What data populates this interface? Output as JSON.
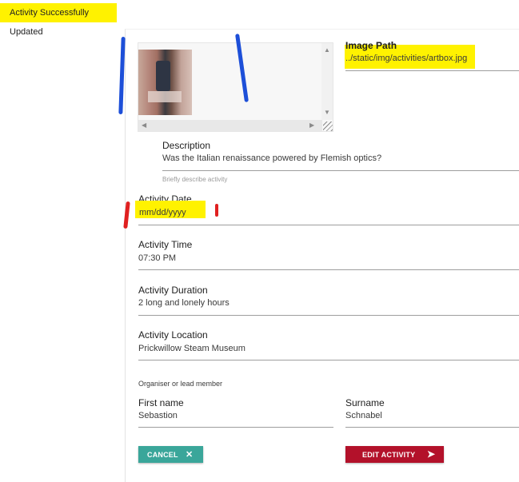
{
  "toast": {
    "message": "Activity Successfully Updated"
  },
  "image": {
    "path_label": "Image Path",
    "path_value": "../static/img/activities/artbox.jpg",
    "up_arrow": "▲",
    "down_arrow": "▼",
    "left_arrow": "◀",
    "right_arrow": "▶"
  },
  "description": {
    "label": "Description",
    "value": "Was the Italian renaissance powered by Flemish optics?",
    "hint": "Briefly describe activity"
  },
  "date": {
    "label": "Activity Date",
    "value": "mm/dd/yyyy"
  },
  "time": {
    "label": "Activity Time",
    "value": "07:30 PM"
  },
  "duration": {
    "label": "Activity Duration",
    "value": "2 long and lonely hours"
  },
  "location": {
    "label": "Activity Location",
    "value": "Prickwillow Steam Museum"
  },
  "organiser": {
    "section_label": "Organiser or lead member",
    "first_name_label": "First name",
    "first_name_value": "Sebastion",
    "surname_label": "Surname",
    "surname_value": "Schnabel"
  },
  "buttons": {
    "cancel_label": "CANCEL",
    "cancel_icon": "✕",
    "edit_label": "EDIT ACTIVITY",
    "edit_icon": "➤"
  },
  "colors": {
    "highlight": "#fff200",
    "cancel": "#3aa69a",
    "edit": "#b3112a",
    "pen_blue": "#1d4fd8",
    "pen_red": "#e02020"
  }
}
